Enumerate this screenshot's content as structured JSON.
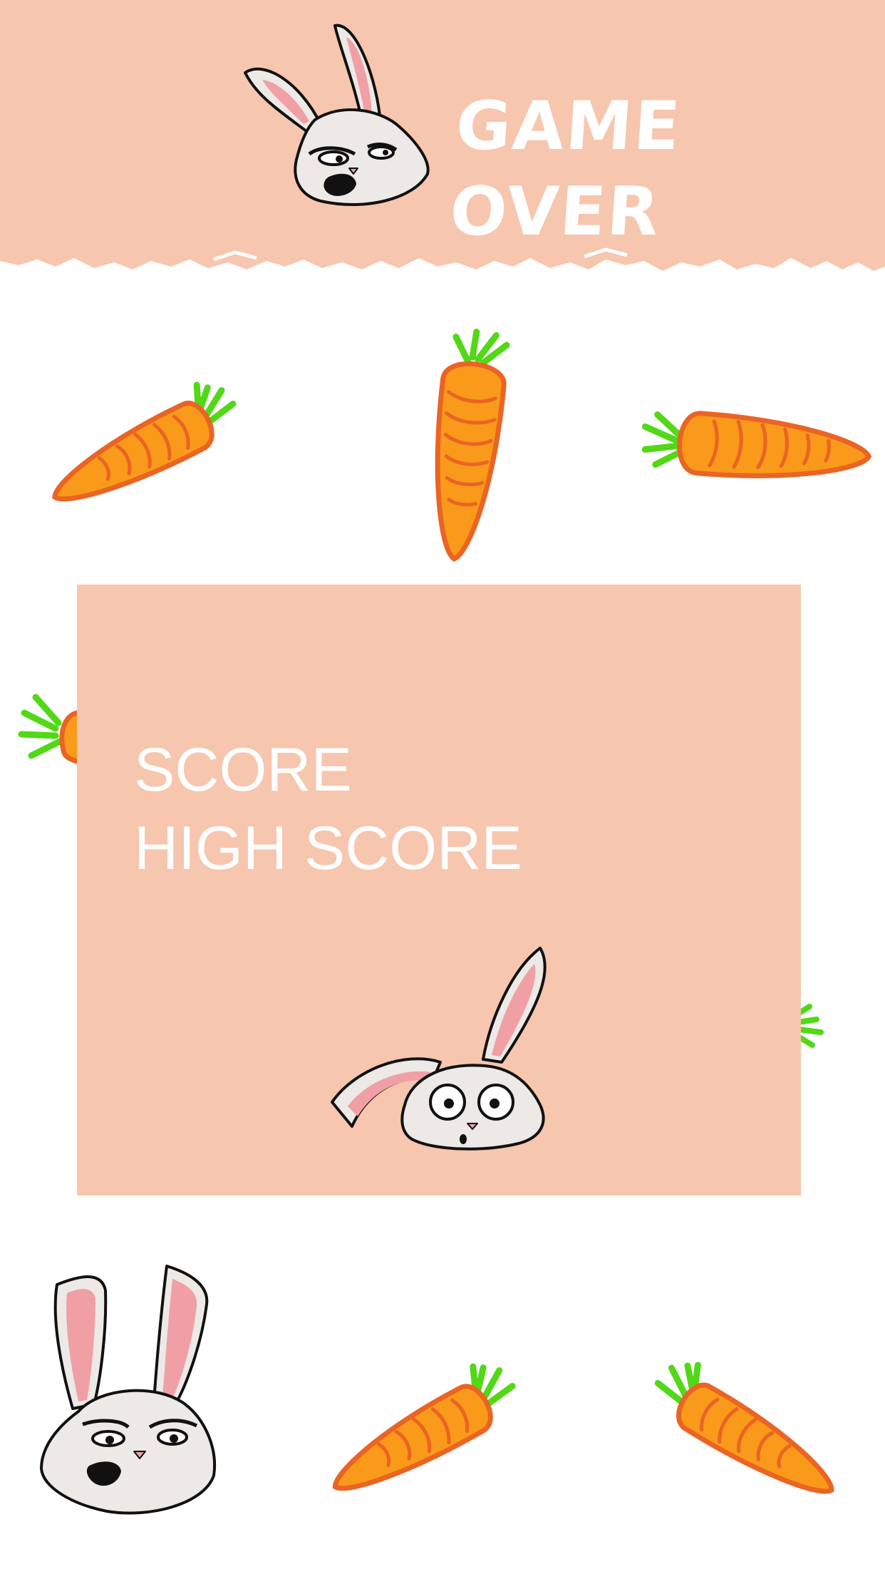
{
  "screen": "game-over",
  "header": {
    "title": "GAME OVER"
  },
  "score_panel": {
    "score_label": "SCORE",
    "high_score_label": "HIGH SCORE"
  },
  "colors": {
    "panel": "#f7c6ae",
    "background": "#ffffff",
    "text": "#ffffff",
    "carrot_body": "#f99a1a",
    "carrot_outline": "#ea6424",
    "carrot_leaves": "#52d816",
    "bunny_fur": "#ece9e6",
    "bunny_ear_inner": "#f0a0a4"
  },
  "sprites": {
    "carrots": [
      "carrot-icon",
      "carrot-icon",
      "carrot-icon",
      "carrot-icon",
      "carrot-icon",
      "carrot-icon",
      "carrot-icon"
    ],
    "bunnies": [
      "annoyed-bunny-icon",
      "shocked-bunny-icon",
      "smug-bunny-icon"
    ]
  }
}
